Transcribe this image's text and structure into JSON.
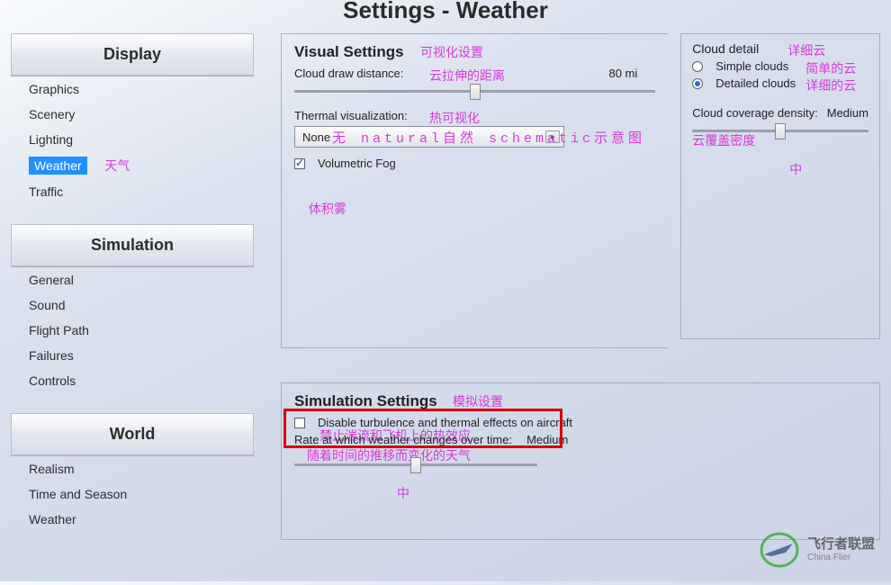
{
  "page_title": "Settings - Weather",
  "sidebar": {
    "sections": [
      {
        "title": "Display",
        "items": [
          "Graphics",
          "Scenery",
          "Lighting",
          "Weather",
          "Traffic"
        ],
        "selected": "Weather",
        "selected_annot": "天气"
      },
      {
        "title": "Simulation",
        "items": [
          "General",
          "Sound",
          "Flight Path",
          "Failures",
          "Controls"
        ]
      },
      {
        "title": "World",
        "items": [
          "Realism",
          "Time and Season",
          "Weather"
        ]
      }
    ]
  },
  "visual": {
    "title": "Visual Settings",
    "title_annot": "可视化设置",
    "draw_dist_label": "Cloud draw distance:",
    "draw_dist_annot": "云拉伸的距离",
    "draw_dist_value": "80 mi",
    "draw_dist_slider_pct": 50,
    "thermal_label": "Thermal visualization:",
    "thermal_annot": "热可视化",
    "thermal_value": "None",
    "thermal_opts_display": "无 natural自然 schematic示意图",
    "fog_label": "Volumetric Fog",
    "fog_checked": true,
    "fog_annot": "体积雾"
  },
  "cloud": {
    "title": "Cloud detail",
    "title_annot": "详细云",
    "opt_simple": "Simple clouds",
    "opt_simple_annot": "简单的云",
    "opt_detailed": "Detailed clouds",
    "opt_detailed_annot": "详细的云",
    "selected": "detailed",
    "density_label": "Cloud coverage density:",
    "density_annot": "云覆盖密度",
    "density_value": "Medium",
    "density_annot2": "中",
    "density_slider_pct": 50
  },
  "sim": {
    "title": "Simulation Settings",
    "title_annot": "模拟设置",
    "disable_label": "Disable turbulence and thermal effects on aircraft",
    "disable_annot": "禁止湍流和飞机上的热效应",
    "disable_checked": false,
    "rate_label": "Rate at which weather changes over time:",
    "rate_value": "Medium",
    "rate_annot": "随着时间的推移而变化的天气",
    "rate_annot2": "中",
    "rate_slider_pct": 50
  },
  "logo": {
    "cn": "飞行者联盟",
    "en": "China Flier"
  }
}
